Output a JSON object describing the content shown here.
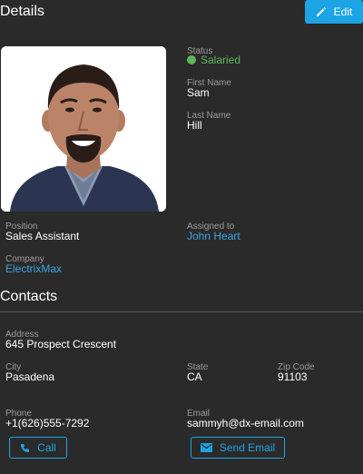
{
  "header": {
    "title": "Details",
    "edit_label": "Edit"
  },
  "details": {
    "status_label": "Status",
    "status_value": "Salaried",
    "first_name_label": "First Name",
    "first_name": "Sam",
    "last_name_label": "Last Name",
    "last_name": "Hill",
    "position_label": "Position",
    "position": "Sales Assistant",
    "assigned_label": "Assigned to",
    "assigned": "John Heart",
    "company_label": "Company",
    "company": "ElectrixMax"
  },
  "contacts": {
    "title": "Contacts",
    "address_label": "Address",
    "address": "645 Prospect Crescent",
    "city_label": "City",
    "city": "Pasadena",
    "state_label": "State",
    "state": "CA",
    "zip_label": "Zip Code",
    "zip": "91103",
    "phone_label": "Phone",
    "phone": "+1(626)555-7292",
    "email_label": "Email",
    "email": "sammyh@dx-email.com",
    "call_label": "Call",
    "send_email_label": "Send Email"
  },
  "colors": {
    "accent": "#1ca4e4",
    "status_green": "#5cb85c",
    "link": "#3aa6e0",
    "background": "#2a2a2a"
  },
  "icons": [
    "pencil-icon",
    "phone-icon",
    "envelope-icon"
  ]
}
